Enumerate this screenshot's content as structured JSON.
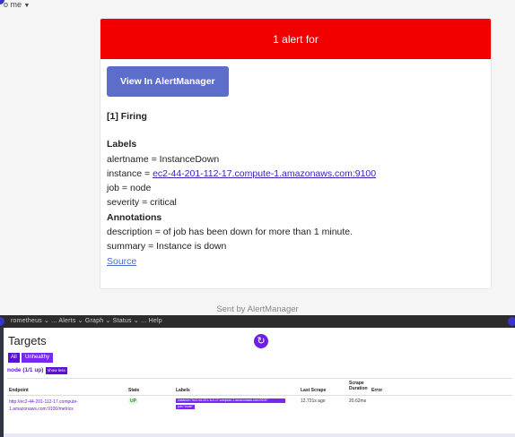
{
  "email": {
    "to_label": "o me",
    "header_text": "1 alert for",
    "button_label": "View In AlertManager",
    "firing_heading": "[1] Firing",
    "labels_heading": "Labels",
    "alertname_line": "alertname = InstanceDown",
    "instance_prefix": "instance = ",
    "instance_link": "ec2-44-201-112-17.compute-1.amazonaws.com:9100",
    "job_line": "job = node",
    "severity_line": "severity = critical",
    "annotations_heading": "Annotations",
    "description_line": "description = of job has been down for more than 1 minute.",
    "summary_line": "summary = Instance is down",
    "source_link": "Source",
    "footer": "Sent by AlertManager",
    "colors": {
      "header_red": "#f20000",
      "button_blue": "#5c6ec9"
    }
  },
  "separator": {
    "tab_text": "rometheus ⌄ ... Alerts ⌄ Graph ⌄ Status ⌄ ... Help"
  },
  "targets": {
    "title": "Targets",
    "filter_all": "All",
    "filter_unhealthy": "Unhealthy",
    "group_label": "node (1/1 up)",
    "show_less": "show less",
    "columns": [
      "Endpoint",
      "State",
      "Labels",
      "Last Scrape",
      "Scrape Duration",
      "Error"
    ],
    "row": {
      "endpoint": "http://ec2-44-201-112-17.compute-1.amazonaws.com:9100/metrics",
      "state": "UP",
      "label_instance": "instance=\"ec2-44-201-112-17.compute-1.amazonaws.com:9100\"",
      "label_job": "job=\"node\"",
      "last_scrape": "12.721s ago",
      "scrape_duration": "20.62ms",
      "error": ""
    },
    "colors": {
      "accent": "#6d1fe3"
    }
  }
}
